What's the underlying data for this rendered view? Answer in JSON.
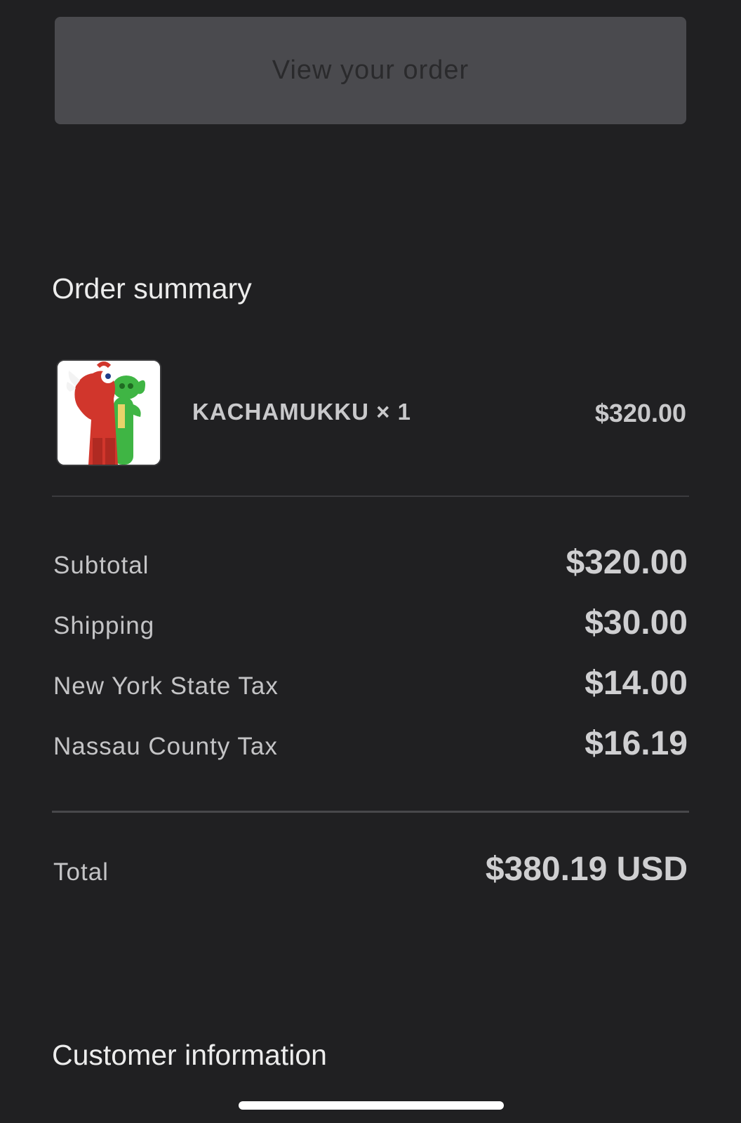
{
  "actions": {
    "view_order_label": "View your order"
  },
  "order_summary": {
    "heading": "Order summary",
    "items": [
      {
        "name": "KACHAMUKKU × 1",
        "price": "$320.00",
        "thumbnail": "kachamukku-figure-image"
      }
    ],
    "costs": {
      "subtotal_label": "Subtotal",
      "subtotal_value": "$320.00",
      "shipping_label": "Shipping",
      "shipping_value": "$30.00",
      "ny_tax_label": "New York State Tax",
      "ny_tax_value": "$14.00",
      "nassau_tax_label": "Nassau County Tax",
      "nassau_tax_value": "$16.19"
    },
    "total": {
      "label": "Total",
      "value": "$380.19 USD"
    }
  },
  "customer_information": {
    "heading": "Customer information"
  },
  "colors": {
    "background": "#202022",
    "button": "#4a4a4e",
    "text": "#c9c9cb"
  }
}
